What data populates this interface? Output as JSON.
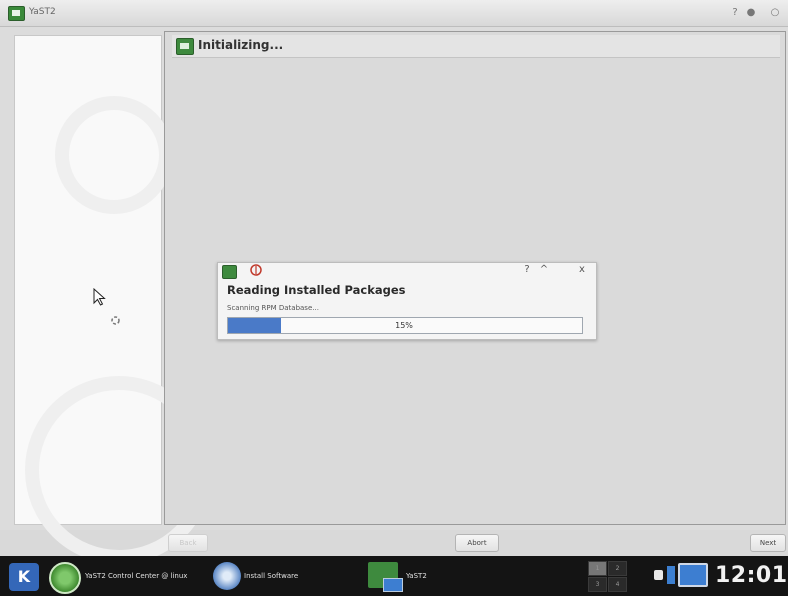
{
  "window": {
    "title": "YaST2"
  },
  "header": {
    "title": "Initializing..."
  },
  "dialog": {
    "title": "Reading Installed Packages",
    "status": "Scanning RPM Database...",
    "progress_text": "15%",
    "progress_fraction": 0.15,
    "help_glyph": "?",
    "shade_glyph": "^",
    "close_glyph": "x"
  },
  "buttons": {
    "back": "Back",
    "abort": "Abort",
    "next": "Next"
  },
  "taskbar": {
    "menu_glyph": "K",
    "tasks": [
      {
        "label": "YaST2 Control Center @ linux",
        "icon": "yast-control-center-icon"
      },
      {
        "label": "Install Software",
        "icon": "install-software-icon"
      },
      {
        "label": "YaST2",
        "icon": "yast-icon"
      }
    ],
    "pager": [
      "1",
      "2",
      "3",
      "4"
    ],
    "clock": "12:01"
  },
  "colors": {
    "progress": "#4a7ac8",
    "taskbar": "#141414",
    "accent_green": "#3e8a3e"
  }
}
